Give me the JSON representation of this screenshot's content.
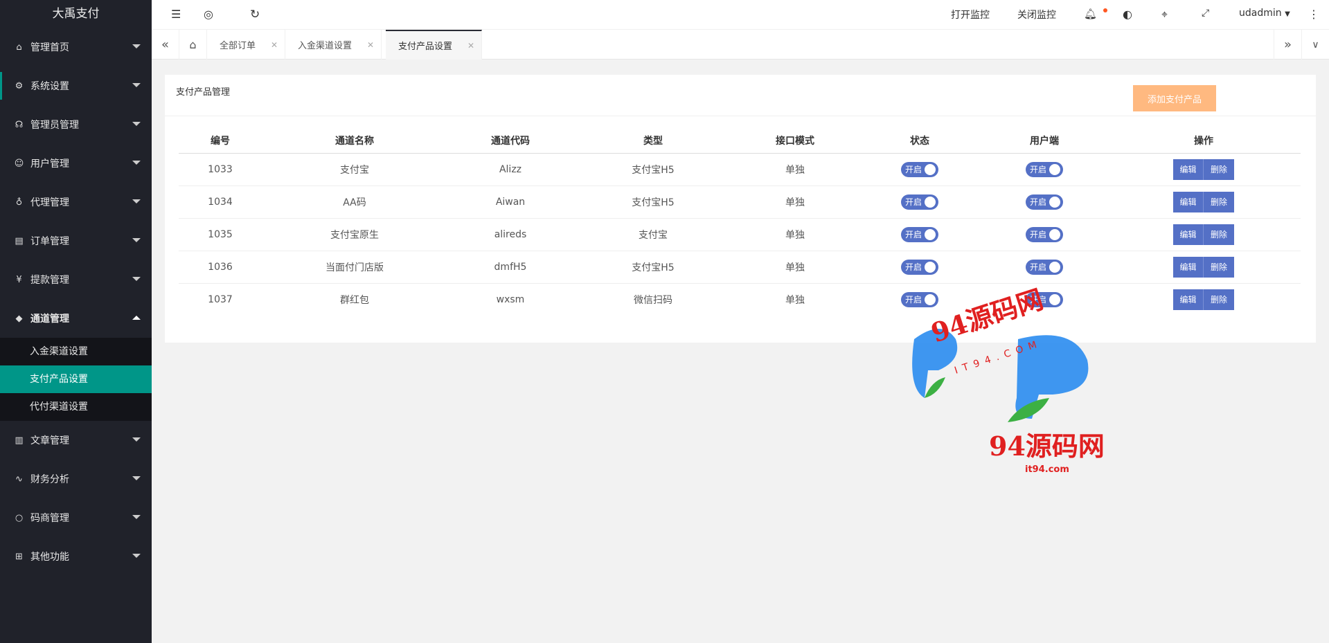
{
  "app": {
    "title": "大禹支付"
  },
  "sidebar": {
    "items": [
      {
        "label": "管理首页",
        "icon": "home-icon",
        "glyph": "⌂"
      },
      {
        "label": "系统设置",
        "icon": "gear-icon",
        "glyph": "⚙"
      },
      {
        "label": "管理员管理",
        "icon": "headset-icon",
        "glyph": "☊"
      },
      {
        "label": "用户管理",
        "icon": "user-icon",
        "glyph": "☺"
      },
      {
        "label": "代理管理",
        "icon": "agent-icon",
        "glyph": "♁"
      },
      {
        "label": "订单管理",
        "icon": "clipboard-icon",
        "glyph": "▤"
      },
      {
        "label": "提款管理",
        "icon": "money-icon",
        "glyph": "¥"
      },
      {
        "label": "通道管理",
        "icon": "diamond-icon",
        "glyph": "◆"
      },
      {
        "label": "文章管理",
        "icon": "document-icon",
        "glyph": "▥"
      },
      {
        "label": "财务分析",
        "icon": "chart-line-icon",
        "glyph": "∿"
      },
      {
        "label": "码商管理",
        "icon": "circle-icon",
        "glyph": "○"
      },
      {
        "label": "其他功能",
        "icon": "apps-icon",
        "glyph": "⊞"
      }
    ],
    "submenu": [
      "入金渠道设置",
      "支付产品设置",
      "代付渠道设置"
    ]
  },
  "header": {
    "open_monitor": "打开监控",
    "close_monitor": "关闭监控",
    "username": "udadmin"
  },
  "tabs": [
    "全部订单",
    "入金渠道设置",
    "支付产品设置"
  ],
  "card": {
    "title": "支付产品管理",
    "add_button": "添加支付产品"
  },
  "table": {
    "headers": [
      "编号",
      "通道名称",
      "通道代码",
      "类型",
      "接口模式",
      "状态",
      "用户端",
      "操作"
    ],
    "rows": [
      [
        "1033",
        "支付宝",
        "Alizz",
        "支付宝H5",
        "单独"
      ],
      [
        "1034",
        "AA码",
        "Aiwan",
        "支付宝H5",
        "单独"
      ],
      [
        "1035",
        "支付宝原生",
        "alireds",
        "支付宝",
        "单独"
      ],
      [
        "1036",
        "当面付门店版",
        "dmfH5",
        "支付宝H5",
        "单独"
      ],
      [
        "1037",
        "群红包",
        "wxsm",
        "微信扫码",
        "单独"
      ]
    ],
    "switch_label": "开启",
    "edit_label": "编辑",
    "delete_label": "删除"
  },
  "watermark": {
    "text": "94源码网",
    "sub": "IT94.COM",
    "domain": "it94.com"
  },
  "colors": {
    "sidebar_bg": "#20222a",
    "accent": "#009688",
    "switch": "#5470c6",
    "add_button": "#ffb980",
    "watermark_red": "#e02020"
  }
}
